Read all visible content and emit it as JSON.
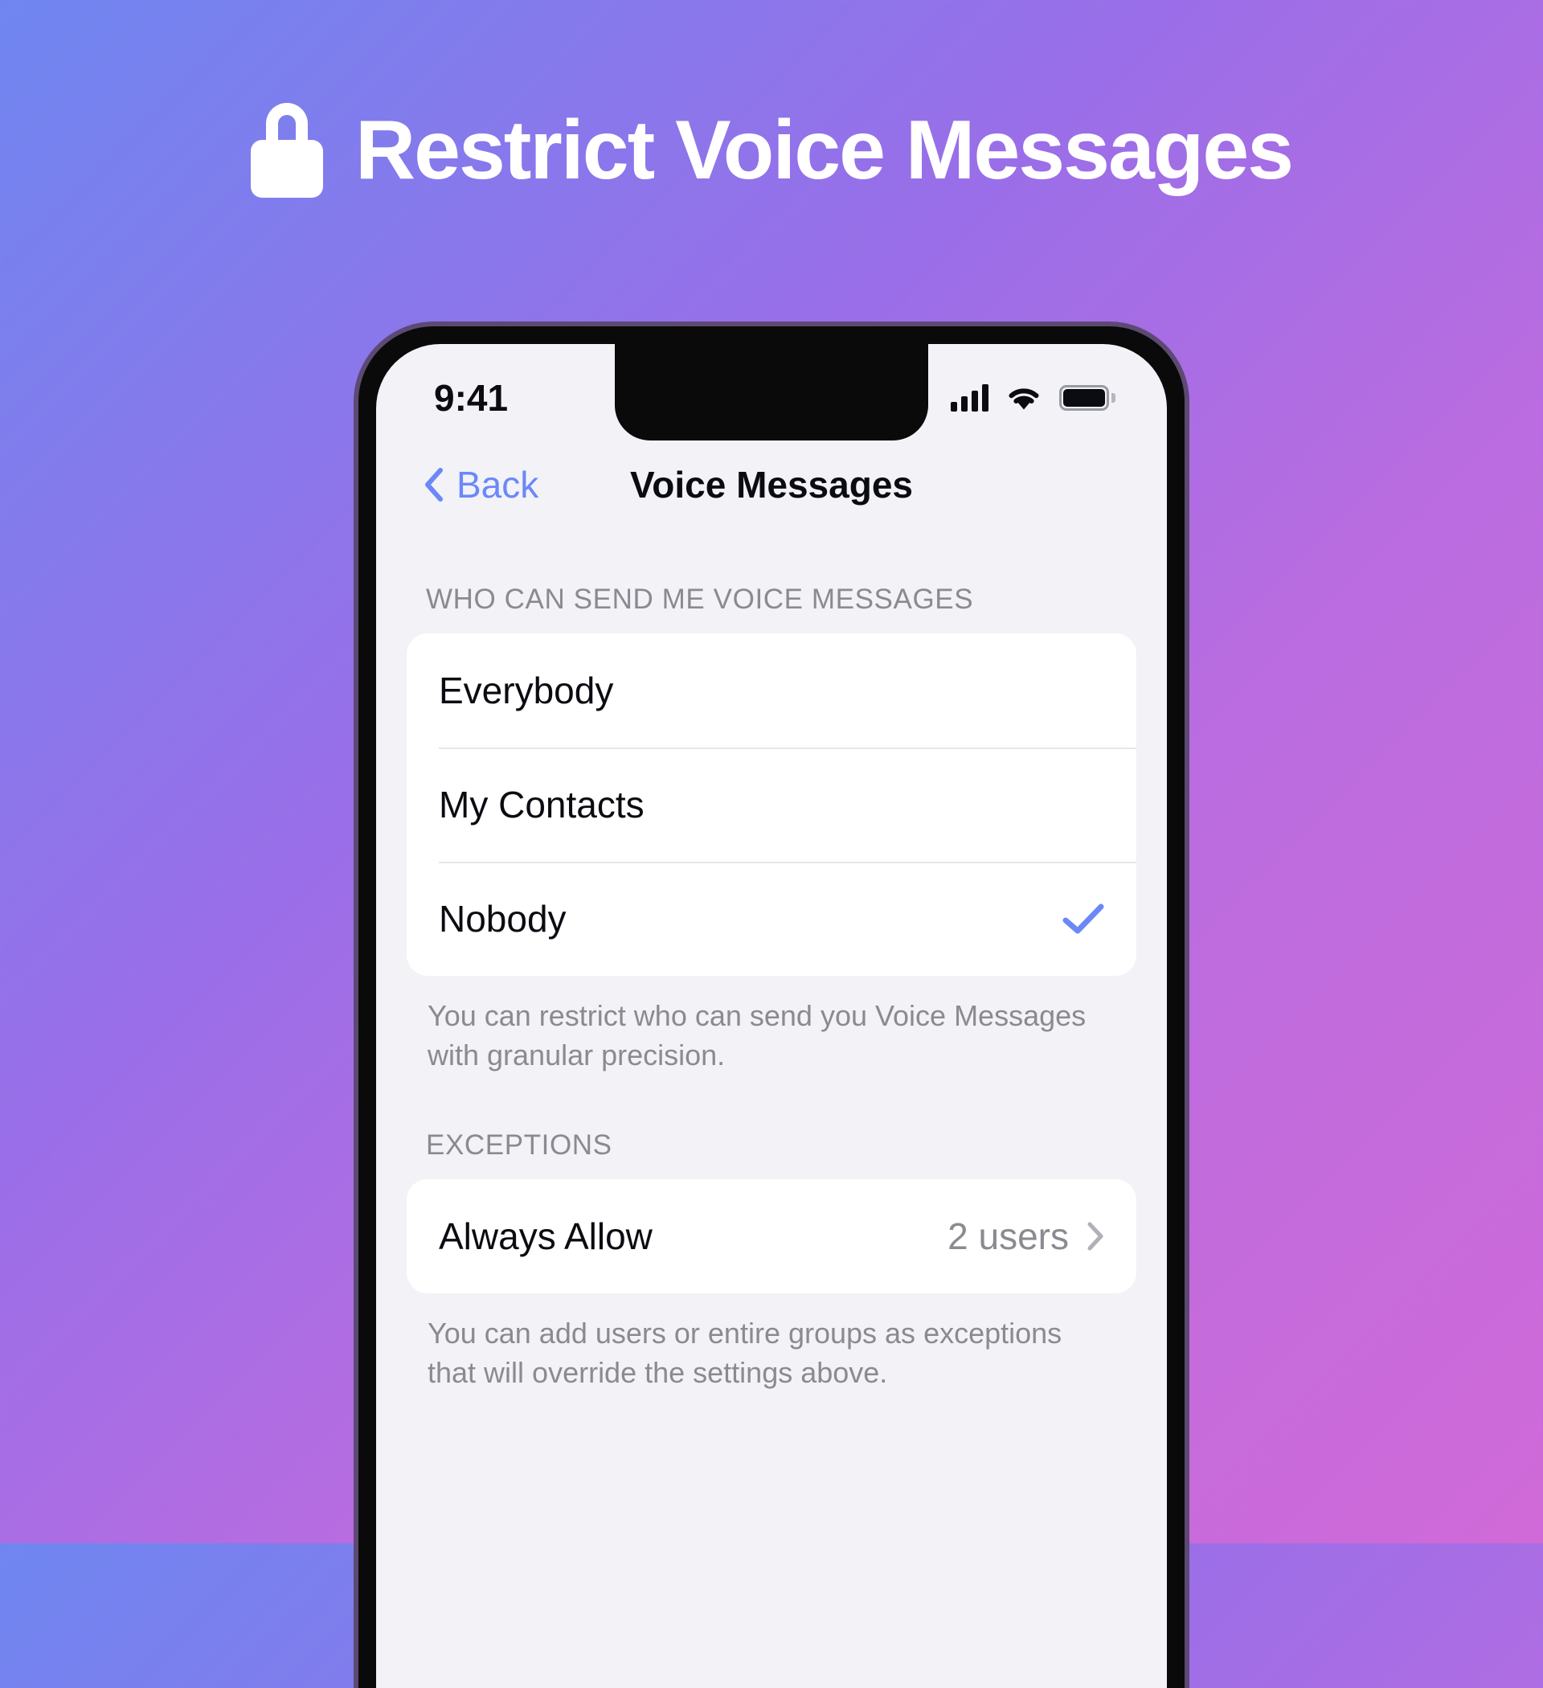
{
  "banner": {
    "icon": "lock-icon",
    "title": "Restrict Voice Messages",
    "background_gradient": [
      "#6f86f0",
      "#9a6ee8",
      "#b96ce0",
      "#d06ad8"
    ]
  },
  "phone": {
    "status_bar": {
      "time": "9:41",
      "cellular_icon": "cellular-signal-icon",
      "wifi_icon": "wifi-icon",
      "battery_icon": "battery-full-icon"
    },
    "nav_bar": {
      "back_label": "Back",
      "back_icon": "chevron-left-icon",
      "title": "Voice Messages",
      "accent_color": "#6b88f7"
    },
    "sections": [
      {
        "header": "WHO CAN SEND ME VOICE MESSAGES",
        "rows": [
          {
            "label": "Everybody",
            "selected": false
          },
          {
            "label": "My Contacts",
            "selected": false
          },
          {
            "label": "Nobody",
            "selected": true,
            "check_icon": "checkmark-icon"
          }
        ],
        "footer": "You can restrict who can send you Voice Messages with granular precision."
      },
      {
        "header": "EXCEPTIONS",
        "rows": [
          {
            "label": "Always Allow",
            "value": "2 users",
            "chevron_icon": "chevron-right-icon"
          }
        ],
        "footer": "You can add users or entire groups as exceptions that will override the settings above."
      }
    ]
  }
}
